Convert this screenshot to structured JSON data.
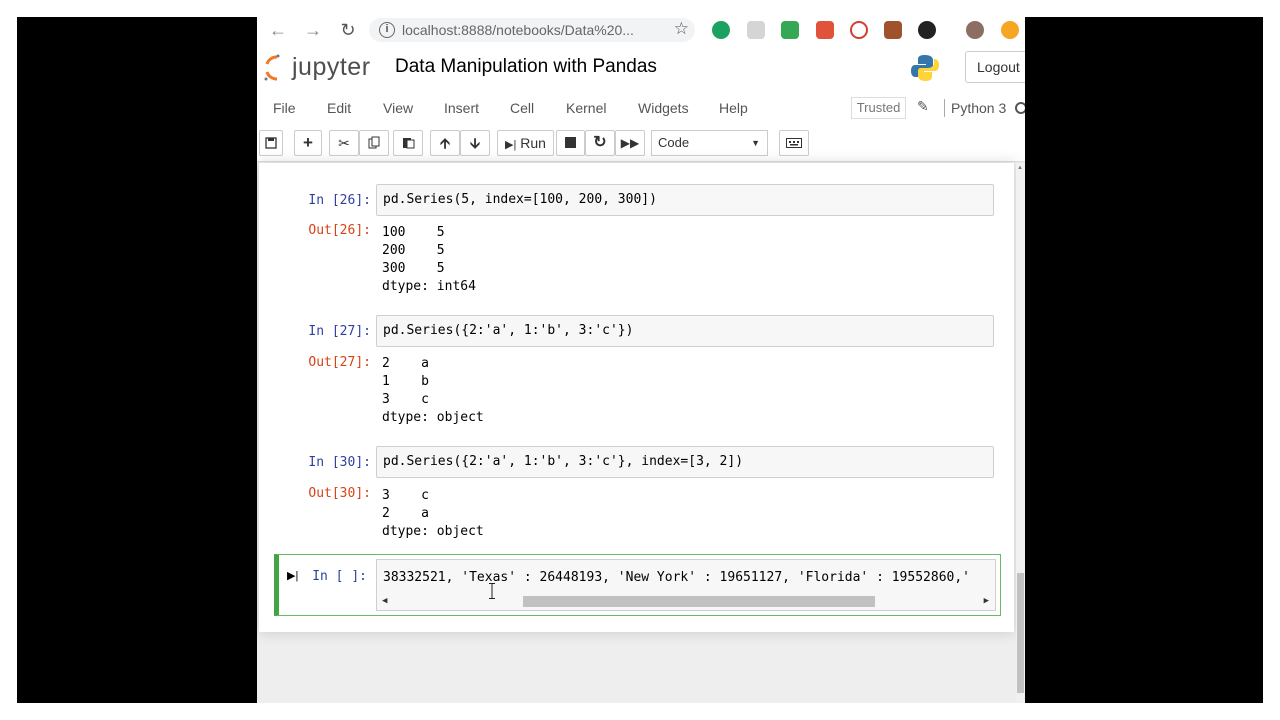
{
  "browser": {
    "url": "localhost:8888/notebooks/Data%20...",
    "back_icon": "arrow-left-icon",
    "forward_icon": "arrow-right-icon",
    "reload_icon": "reload-icon",
    "bookmark_icon": "star-icon"
  },
  "header": {
    "logo_text": "jupyter",
    "notebook_title": "Data Manipulation with Pandas",
    "logout_label": "Logout"
  },
  "menu": {
    "items": [
      "File",
      "Edit",
      "View",
      "Insert",
      "Cell",
      "Kernel",
      "Widgets",
      "Help"
    ],
    "trusted_label": "Trusted",
    "kernel_label": "Python 3"
  },
  "toolbar": {
    "run_label": "Run",
    "cell_type": "Code"
  },
  "cells": [
    {
      "in_prompt": "In [26]:",
      "code": "pd.Series(5, index=[100, 200, 300])",
      "out_prompt": "Out[26]:",
      "output": [
        "100    5",
        "200    5",
        "300    5",
        "dtype: int64"
      ]
    },
    {
      "in_prompt": "In [27]:",
      "code": "pd.Series({2:'a', 1:'b', 3:'c'})",
      "out_prompt": "Out[27]:",
      "output": [
        "2    a",
        "1    b",
        "3    c",
        "dtype: object"
      ]
    },
    {
      "in_prompt": "In [30]:",
      "code": "pd.Series({2:'a', 1:'b', 3:'c'}, index=[3, 2])",
      "out_prompt": "Out[30]:",
      "output": [
        "3    c",
        "2    a",
        "dtype: object"
      ]
    }
  ],
  "active_cell": {
    "in_prompt": "In [ ]:",
    "code": "38332521, 'Texas' : 26448193, 'New York' : 19651127, 'Florida' : 19552860,'"
  },
  "colors": {
    "in_prompt": "#303f9f",
    "out_prompt": "#d84315",
    "active_border": "#42a545"
  }
}
